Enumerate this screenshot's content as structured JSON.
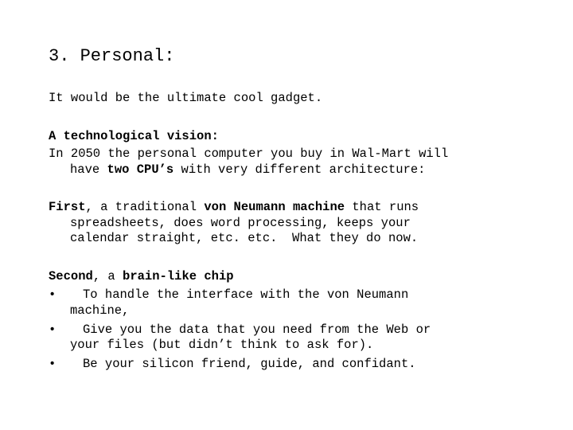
{
  "title": "3. Personal:",
  "intro": "It would be the ultimate cool gadget.",
  "vision": {
    "heading": "A technological vision:",
    "line1": "In 2050 the personal computer you buy in Wal-Mart will",
    "line2_pre": "have ",
    "line2_bold": "two CPU’s",
    "line2_post": " with very different architecture:"
  },
  "first": {
    "label": "First",
    "pre": ", a traditional ",
    "bold": "von Neumann machine",
    "post": " that runs",
    "line2": "spreadsheets, does word processing, keeps your",
    "line3": "calendar straight, etc. etc.  What they do now."
  },
  "second": {
    "label": "Second",
    "pre": ", a ",
    "bold": "brain-like chip",
    "bullet_glyph": "•",
    "bullets": [
      {
        "line1": "To handle the interface with the von Neumann",
        "line2": "machine,"
      },
      {
        "line1": "Give you the data that you need from the Web or",
        "line2": "your files (but didn’t think to ask for)."
      },
      {
        "line1": "Be your silicon friend, guide, and confidant."
      }
    ]
  }
}
